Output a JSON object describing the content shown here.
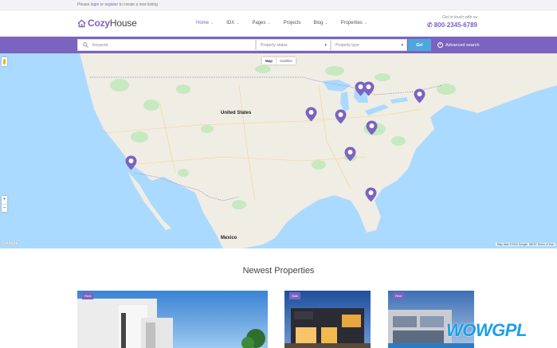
{
  "topbar": {
    "prefix": "Please",
    "login": "login",
    "or": "or",
    "register": "register",
    "suffix": "to create a new listing"
  },
  "header": {
    "logo_part1": "Cozy",
    "logo_part2": "House",
    "nav": [
      {
        "label": "Home",
        "active": true,
        "dropdown": true
      },
      {
        "label": "IDX",
        "active": false,
        "dropdown": true
      },
      {
        "label": "Pages",
        "active": false,
        "dropdown": true
      },
      {
        "label": "Projects",
        "active": false,
        "dropdown": false
      },
      {
        "label": "Blog",
        "active": false,
        "dropdown": true
      },
      {
        "label": "Properties",
        "active": false,
        "dropdown": true
      }
    ],
    "contact_label": "Get in touch with us",
    "phone": "800-2345-6789"
  },
  "search": {
    "keyword_placeholder": "Keyword",
    "status_placeholder": "Property status",
    "type_placeholder": "Property type",
    "go_label": "Go!",
    "advanced_label": "Advanced search"
  },
  "map": {
    "type_map": "Map",
    "type_satellite": "Satellite",
    "zoom_in": "+",
    "zoom_out": "−",
    "label_us": "United States",
    "label_mexico": "Mexico",
    "google": "Google",
    "attribution": "Map data ©2018 Google, INEGI   Terms of Use",
    "pin_count": 10
  },
  "newest": {
    "title": "Newest Properties",
    "cards": [
      {
        "badge": "Rent"
      },
      {
        "badge": "Sale"
      },
      {
        "badge": "Rent"
      }
    ]
  },
  "watermark": {
    "part1": "WOW",
    "part2": "GPL"
  },
  "colors": {
    "accent": "#7b63c0",
    "go_button": "#4da7dd",
    "water": "#aadaff",
    "land": "#f0ede4",
    "parks": "#c7e9c0"
  }
}
